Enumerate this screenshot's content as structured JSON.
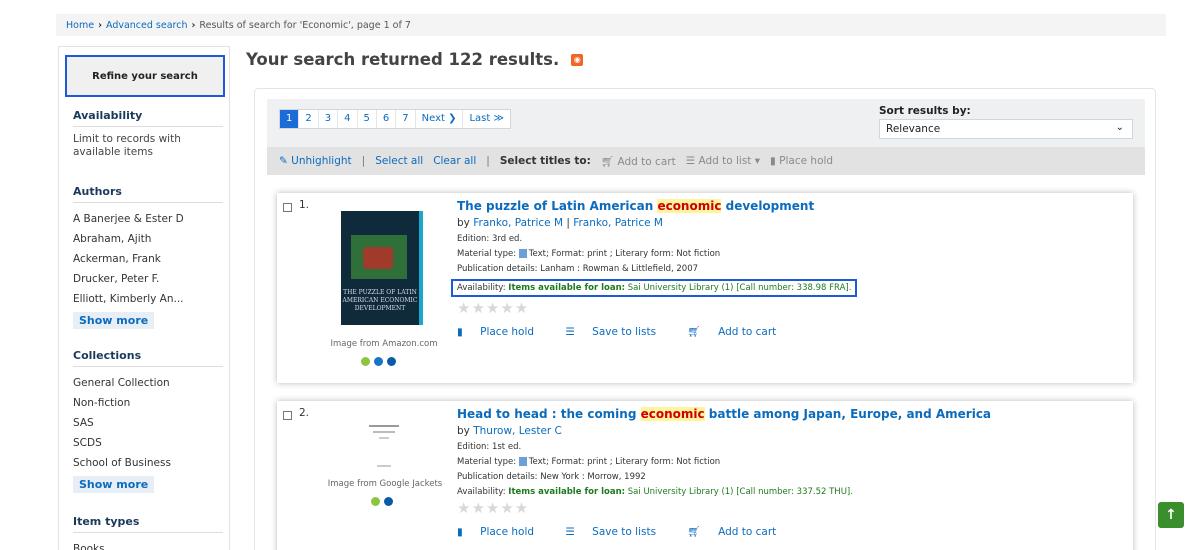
{
  "breadcrumb": {
    "home": "Home",
    "advanced": "Advanced search",
    "current": "Results of search for 'Economic', page 1 of 7"
  },
  "sidebar": {
    "refine": "Refine your search",
    "availability": {
      "title": "Availability",
      "text": "Limit to records with available items"
    },
    "authors": {
      "title": "Authors",
      "items": [
        "A Banerjee & Ester D",
        "Abraham, Ajith",
        "Ackerman, Frank",
        "Drucker, Peter F.",
        "Elliott, Kimberly An..."
      ],
      "show_more": "Show more"
    },
    "collections": {
      "title": "Collections",
      "items": [
        "General Collection",
        "Non-fiction",
        "SAS",
        "SCDS",
        "School of Business"
      ],
      "show_more": "Show more"
    },
    "item_types": {
      "title": "Item types",
      "items": [
        "Books"
      ]
    }
  },
  "main": {
    "title": "Your search returned 122 results.",
    "rss_icon": "rss-icon"
  },
  "pager": {
    "pages": [
      "1",
      "2",
      "3",
      "4",
      "5",
      "6",
      "7"
    ],
    "active": "1",
    "next": "Next ❯",
    "last": "Last ≫"
  },
  "sort": {
    "label": "Sort results by:",
    "value": "Relevance"
  },
  "toolbar": {
    "unhighlight": "✎ Unhighlight",
    "select_all": "Select all",
    "clear_all": "Clear all",
    "select_titles": "Select titles to:",
    "add_to_cart": "Add to cart",
    "add_to_list": "Add to list ▾",
    "place_hold": "Place hold"
  },
  "records": [
    {
      "num": "1.",
      "title_pre": "The puzzle of Latin American ",
      "title_hl": "economic",
      "title_post": " development",
      "by_label": "by",
      "author1": "Franko, Patrice M",
      "author2": "Franko, Patrice M",
      "edition": "Edition: 3rd ed.",
      "material": "Material type:",
      "material_rest": "Text; Format: print ; Literary form: Not fiction",
      "publication": "Publication details: Lanham : Rowman & Littlefield, 2007",
      "avail_label": "Availability:",
      "avail_bold": "Items available for loan:",
      "avail_rest": "Sai University Library (1) [Call number: 338.98 FRA].",
      "cover_text": "THE PUZZLE OF LATIN AMERICAN ECONOMIC DEVELOPMENT",
      "img_from": "Image from Amazon.com",
      "place_hold": "Place hold",
      "save_to_lists": "Save to lists",
      "add_to_cart": "Add to cart"
    },
    {
      "num": "2.",
      "title_pre": "Head to head : the coming ",
      "title_hl": "economic",
      "title_post": " battle among Japan, Europe, and America",
      "by_label": "by",
      "author1": "Thurow, Lester C",
      "edition": "Edition: 1st ed.",
      "material": "Material type:",
      "material_rest": "Text; Format: print ; Literary form: Not fiction",
      "publication": "Publication details: New York : Morrow, 1992",
      "avail_label": "Availability:",
      "avail_bold": "Items available for loan:",
      "avail_rest": "Sai University Library (1) [Call number: 337.52 THU].",
      "img_from": "Image from Google Jackets",
      "place_hold": "Place hold",
      "save_to_lists": "Save to lists",
      "add_to_cart": "Add to cart"
    }
  ],
  "colors": {
    "accent": "#0b6bbd",
    "highlight_box": "#1d5bd6",
    "available": "#1f7a1f",
    "to_top": "#3a8e2b"
  }
}
